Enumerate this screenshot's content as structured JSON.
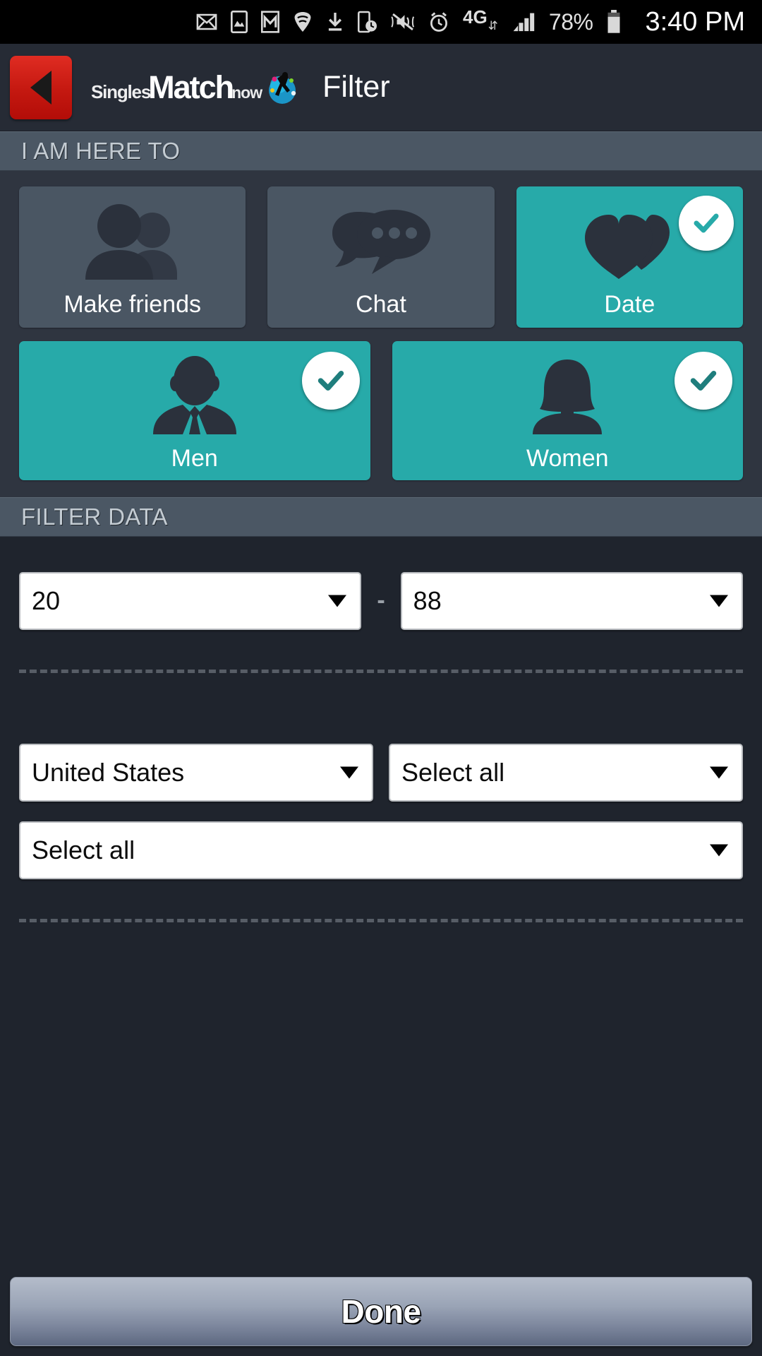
{
  "status_bar": {
    "icons": [
      "mail-icon",
      "photo-icon",
      "gmail-icon",
      "wifi-icon",
      "download-icon",
      "phone-clock-icon",
      "mute-vibrate-icon",
      "alarm-icon",
      "network-4g-icon",
      "signal-bars-icon"
    ],
    "network_label": "4G",
    "battery_percent": "78%",
    "clock": "3:40 PM"
  },
  "action_bar": {
    "back_icon": "back-triangle-icon",
    "brand": {
      "singles": "Singles",
      "match": "Match",
      "now": "now",
      "logo_icon": "dancer-logo-icon"
    },
    "title": "Filter"
  },
  "sections": {
    "here_to": {
      "header": "I AM HERE TO",
      "purpose_tiles": [
        {
          "label": "Make friends",
          "icon": "two-people-icon",
          "selected": false
        },
        {
          "label": "Chat",
          "icon": "speech-bubbles-icon",
          "selected": false
        },
        {
          "label": "Date",
          "icon": "hearts-icon",
          "selected": true
        }
      ],
      "gender_tiles": [
        {
          "label": "Men",
          "icon": "man-suit-icon",
          "selected": true
        },
        {
          "label": "Women",
          "icon": "woman-icon",
          "selected": true
        }
      ]
    },
    "filter_data": {
      "header": "FILTER DATA",
      "age_from": {
        "value": "20",
        "placeholder": "20"
      },
      "age_separator": "-",
      "age_to": {
        "value": "88",
        "placeholder": "88"
      },
      "country": {
        "value": "United States",
        "placeholder": "Select all"
      },
      "region": {
        "value": "Select all",
        "placeholder": "Select all"
      },
      "city": {
        "value": "Select all",
        "placeholder": "Select all"
      }
    }
  },
  "footer": {
    "done_label": "Done"
  },
  "colors": {
    "accent_teal": "#27aaa9",
    "selected_icon": "#2b313c",
    "tile_unselected": "#4a5663",
    "section_header_bg": "#4b5764",
    "back_button_red": "#c41810",
    "page_bg": "#1f242d"
  }
}
